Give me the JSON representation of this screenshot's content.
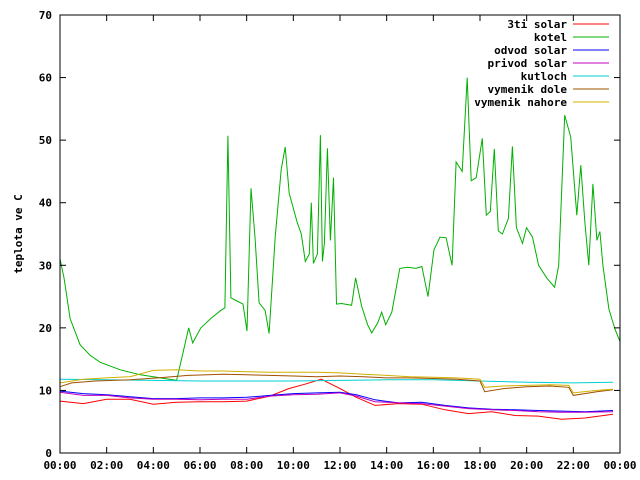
{
  "chart_data": {
    "type": "line",
    "title": "",
    "xlabel": "",
    "ylabel": "teplota ve C",
    "xlim": [
      0,
      24
    ],
    "ylim": [
      0,
      70
    ],
    "x_ticks": [
      "00:00",
      "02:00",
      "04:00",
      "06:00",
      "08:00",
      "10:00",
      "12:00",
      "14:00",
      "16:00",
      "18:00",
      "20:00",
      "22:00",
      "00:00"
    ],
    "y_ticks": [
      0,
      10,
      20,
      30,
      40,
      50,
      60,
      70
    ],
    "grid": false,
    "legend_position": "top-right",
    "series": [
      {
        "name": "3ti solar",
        "color": "#ff0000",
        "points": [
          [
            0,
            8.3
          ],
          [
            1,
            7.9
          ],
          [
            2,
            8.6
          ],
          [
            3,
            8.6
          ],
          [
            4,
            7.8
          ],
          [
            5,
            8.1
          ],
          [
            6,
            8.2
          ],
          [
            7,
            8.2
          ],
          [
            8,
            8.3
          ],
          [
            9,
            9.1
          ],
          [
            9.8,
            10.3
          ],
          [
            10.5,
            11.0
          ],
          [
            11.2,
            11.8
          ],
          [
            12,
            10.3
          ],
          [
            12.7,
            8.9
          ],
          [
            13.5,
            7.6
          ],
          [
            14.5,
            7.9
          ],
          [
            15.5,
            7.8
          ],
          [
            16.5,
            6.9
          ],
          [
            17.5,
            6.3
          ],
          [
            18.5,
            6.6
          ],
          [
            19.5,
            6.0
          ],
          [
            20.5,
            5.9
          ],
          [
            21.5,
            5.4
          ],
          [
            22.5,
            5.6
          ],
          [
            23.7,
            6.2
          ]
        ]
      },
      {
        "name": "kotel",
        "color": "#00b000",
        "points": [
          [
            0,
            31.0
          ],
          [
            0.2,
            28.0
          ],
          [
            0.5,
            21.5
          ],
          [
            1,
            17.3
          ],
          [
            1.5,
            15.6
          ],
          [
            2,
            14.5
          ],
          [
            3,
            13.3
          ],
          [
            4,
            12.5
          ],
          [
            5,
            12.0
          ],
          [
            5.8,
            11.6
          ],
          [
            6.1,
            15.8
          ],
          [
            6.4,
            20.0
          ],
          [
            6.6,
            17.6
          ],
          [
            7,
            20.0
          ],
          [
            7.5,
            21.5
          ],
          [
            8,
            22.8
          ],
          [
            8.2,
            23.2
          ],
          [
            8.35,
            50.7
          ],
          [
            8.5,
            24.8
          ],
          [
            8.8,
            24.3
          ],
          [
            9.1,
            23.8
          ],
          [
            9.3,
            19.5
          ],
          [
            9.5,
            42.3
          ],
          [
            9.7,
            34.5
          ],
          [
            9.9,
            24.0
          ],
          [
            10.2,
            22.8
          ],
          [
            10.4,
            19.1
          ],
          [
            10.7,
            34.5
          ],
          [
            11.0,
            45.3
          ],
          [
            11.2,
            48.9
          ],
          [
            11.4,
            41.5
          ],
          [
            11.8,
            36.8
          ],
          [
            12.0,
            35.0
          ],
          [
            12.2,
            30.6
          ],
          [
            12.4,
            31.8
          ],
          [
            12.5,
            40.0
          ],
          [
            12.6,
            30.3
          ],
          [
            12.8,
            31.8
          ],
          [
            12.95,
            50.8
          ],
          [
            13.05,
            30.6
          ],
          [
            13.15,
            33.5
          ],
          [
            13.3,
            48.7
          ],
          [
            13.45,
            34.0
          ],
          [
            13.6,
            44.0
          ],
          [
            13.75,
            23.8
          ],
          [
            14.0,
            23.9
          ],
          [
            14.5,
            23.6
          ],
          [
            14.7,
            28.0
          ],
          [
            15.0,
            23.5
          ],
          [
            15.3,
            20.5
          ],
          [
            15.5,
            19.2
          ],
          [
            15.8,
            20.8
          ],
          [
            16.0,
            22.5
          ],
          [
            16.2,
            20.5
          ],
          [
            16.5,
            22.5
          ],
          [
            16.9,
            29.5
          ],
          [
            17.3,
            29.7
          ],
          [
            17.7,
            29.5
          ],
          [
            18.0,
            29.8
          ],
          [
            18.3,
            25.0
          ],
          [
            18.6,
            32.5
          ],
          [
            18.9,
            34.5
          ],
          [
            19.2,
            34.4
          ],
          [
            19.5,
            30.0
          ],
          [
            19.7,
            46.5
          ],
          [
            20.0,
            45.0
          ],
          [
            20.25,
            60.0
          ],
          [
            20.45,
            43.5
          ],
          [
            20.7,
            44.0
          ],
          [
            21.0,
            50.3
          ],
          [
            21.2,
            38.0
          ],
          [
            21.4,
            38.6
          ],
          [
            21.6,
            48.6
          ],
          [
            21.8,
            35.5
          ],
          [
            22.0,
            35.0
          ],
          [
            22.3,
            37.5
          ],
          [
            22.5,
            49.0
          ],
          [
            22.7,
            36.0
          ],
          [
            23.0,
            33.5
          ],
          [
            23.2,
            36.0
          ],
          [
            23.5,
            34.5
          ],
          [
            23.8,
            30.0
          ],
          [
            24.2,
            28.0
          ],
          [
            24.6,
            26.5
          ],
          [
            24.8,
            30.0
          ],
          [
            25.1,
            54.0
          ],
          [
            25.4,
            50.5
          ],
          [
            25.7,
            38.0
          ],
          [
            25.9,
            46.0
          ],
          [
            26.1,
            37.0
          ],
          [
            26.3,
            30.0
          ],
          [
            26.5,
            43.0
          ],
          [
            26.7,
            34.0
          ],
          [
            26.85,
            35.4
          ],
          [
            27.0,
            30.0
          ],
          [
            27.3,
            23.0
          ],
          [
            27.6,
            19.8
          ],
          [
            27.85,
            17.8
          ]
        ]
      },
      {
        "name": "odvod solar",
        "color": "#0000ff",
        "points": [
          [
            0,
            9.9
          ],
          [
            1,
            9.5
          ],
          [
            2,
            9.3
          ],
          [
            3,
            9.0
          ],
          [
            4,
            8.7
          ],
          [
            5,
            8.7
          ],
          [
            6,
            8.8
          ],
          [
            7,
            8.8
          ],
          [
            8,
            8.9
          ],
          [
            9,
            9.2
          ],
          [
            10,
            9.5
          ],
          [
            11,
            9.6
          ],
          [
            12,
            9.7
          ],
          [
            12.7,
            9.3
          ],
          [
            13.5,
            8.5
          ],
          [
            14.5,
            8.0
          ],
          [
            15.5,
            8.1
          ],
          [
            16.5,
            7.6
          ],
          [
            17.5,
            7.2
          ],
          [
            18.5,
            7.0
          ],
          [
            19.5,
            6.9
          ],
          [
            20.5,
            6.8
          ],
          [
            21.5,
            6.7
          ],
          [
            22.5,
            6.6
          ],
          [
            23.7,
            6.8
          ]
        ]
      },
      {
        "name": "privod solar",
        "color": "#c000c0",
        "points": [
          [
            0,
            9.7
          ],
          [
            1,
            9.2
          ],
          [
            2,
            9.2
          ],
          [
            3,
            8.8
          ],
          [
            4,
            8.6
          ],
          [
            5,
            8.6
          ],
          [
            6,
            8.5
          ],
          [
            7,
            8.6
          ],
          [
            8,
            8.6
          ],
          [
            9,
            9.1
          ],
          [
            10,
            9.3
          ],
          [
            11,
            9.4
          ],
          [
            12,
            9.6
          ],
          [
            12.7,
            9.1
          ],
          [
            13.5,
            8.2
          ],
          [
            14.5,
            8.0
          ],
          [
            15.5,
            7.9
          ],
          [
            16.5,
            7.5
          ],
          [
            17.5,
            7.1
          ],
          [
            18.5,
            6.9
          ],
          [
            19.5,
            6.8
          ],
          [
            20.5,
            6.6
          ],
          [
            21.5,
            6.5
          ],
          [
            22.5,
            6.5
          ],
          [
            23.7,
            6.6
          ]
        ]
      },
      {
        "name": "kutloch",
        "color": "#00d0d0",
        "points": [
          [
            0,
            11.8
          ],
          [
            2,
            11.7
          ],
          [
            4,
            11.6
          ],
          [
            6,
            11.5
          ],
          [
            8,
            11.5
          ],
          [
            10,
            11.5
          ],
          [
            12,
            11.6
          ],
          [
            14,
            11.7
          ],
          [
            16,
            11.7
          ],
          [
            18,
            11.5
          ],
          [
            20,
            11.3
          ],
          [
            22,
            11.2
          ],
          [
            23.7,
            11.3
          ]
        ]
      },
      {
        "name": "vymenik dole",
        "color": "#a05000",
        "points": [
          [
            0,
            10.6
          ],
          [
            0.5,
            11.2
          ],
          [
            1.5,
            11.5
          ],
          [
            3,
            11.7
          ],
          [
            4.2,
            12.0
          ],
          [
            5.5,
            12.4
          ],
          [
            7,
            12.6
          ],
          [
            8,
            12.5
          ],
          [
            9,
            12.4
          ],
          [
            10,
            12.3
          ],
          [
            11,
            12.2
          ],
          [
            12,
            12.3
          ],
          [
            13,
            12.2
          ],
          [
            14,
            12.0
          ],
          [
            15,
            12.0
          ],
          [
            16,
            11.9
          ],
          [
            17,
            11.8
          ],
          [
            18,
            11.5
          ],
          [
            18.2,
            9.8
          ],
          [
            19,
            10.3
          ],
          [
            20,
            10.6
          ],
          [
            21,
            10.7
          ],
          [
            21.8,
            10.5
          ],
          [
            22,
            9.2
          ],
          [
            23,
            9.8
          ],
          [
            23.7,
            10.1
          ]
        ]
      },
      {
        "name": "vymenik nahore",
        "color": "#d0b000",
        "points": [
          [
            0,
            11.2
          ],
          [
            1,
            11.8
          ],
          [
            2,
            12.0
          ],
          [
            3,
            12.2
          ],
          [
            4,
            13.2
          ],
          [
            5,
            13.3
          ],
          [
            6,
            13.1
          ],
          [
            7,
            13.1
          ],
          [
            8,
            13.0
          ],
          [
            9,
            12.9
          ],
          [
            10,
            12.9
          ],
          [
            11,
            12.9
          ],
          [
            12,
            12.8
          ],
          [
            13,
            12.6
          ],
          [
            14,
            12.4
          ],
          [
            15,
            12.2
          ],
          [
            16,
            12.1
          ],
          [
            17,
            12.0
          ],
          [
            18,
            11.8
          ],
          [
            18.2,
            10.5
          ],
          [
            19,
            10.7
          ],
          [
            20,
            10.8
          ],
          [
            21,
            10.9
          ],
          [
            21.8,
            10.8
          ],
          [
            22,
            9.6
          ],
          [
            23,
            10.0
          ],
          [
            23.7,
            10.2
          ]
        ]
      }
    ]
  }
}
